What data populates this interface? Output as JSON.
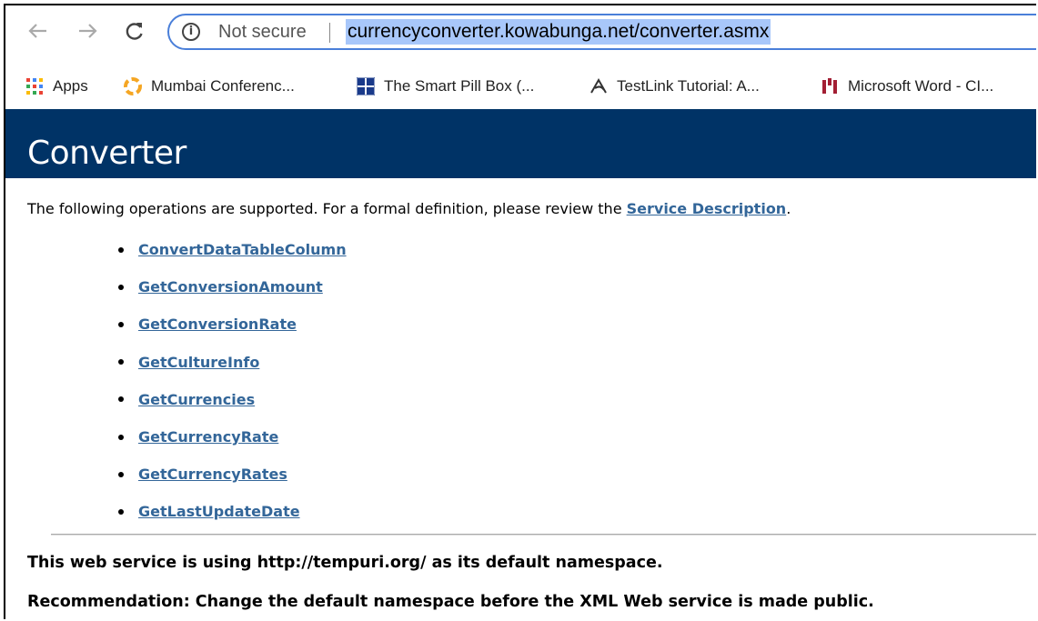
{
  "browser": {
    "back_label": "←",
    "forward_label": "→",
    "reload_label": "C",
    "info_glyph": "i",
    "security_text": "Not secure",
    "url": "currencyconverter.kowabunga.net/converter.asmx"
  },
  "bookmarks": [
    {
      "label": "Apps",
      "icon": "apps-grid-icon"
    },
    {
      "label": "Mumbai Conferenc...",
      "icon": "conference-logo-icon"
    },
    {
      "label": "The Smart Pill Box (...",
      "icon": "rerc-logo-icon"
    },
    {
      "label": "TestLink Tutorial: A...",
      "icon": "guru-logo-icon"
    },
    {
      "label": "Microsoft Word - CI...",
      "icon": "document-logo-icon"
    }
  ],
  "page": {
    "title": "Converter",
    "intro_text": "The following operations are supported. For a formal definition, please review the ",
    "service_link": "Service Description",
    "intro_end": ".",
    "operations": [
      "ConvertDataTableColumn",
      "GetConversionAmount",
      "GetConversionRate",
      "GetCultureInfo",
      "GetCurrencies",
      "GetCurrencyRate",
      "GetCurrencyRates",
      "GetLastUpdateDate"
    ],
    "namespace_note": "This web service is using http://tempuri.org/ as its default namespace.",
    "recommendation": "Recommendation: Change the default namespace before the XML Web service is made public."
  },
  "colors": {
    "header_bg": "#003366",
    "link": "#336699",
    "url_highlight": "#a8c7fa",
    "omnibox_border": "#4a7fd9"
  }
}
